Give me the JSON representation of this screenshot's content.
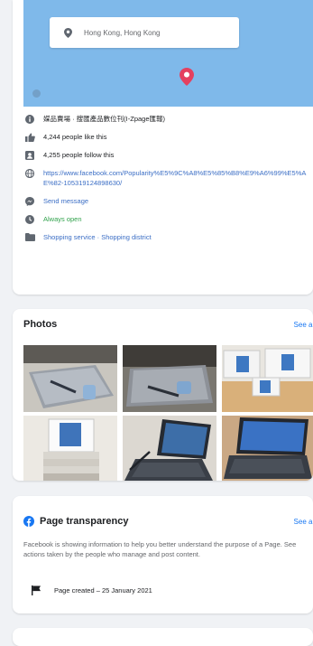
{
  "map": {
    "search_text": "Hong Kong, Hong Kong"
  },
  "info": {
    "category": "媒品賣場 · 搜匯產品數位刊(I-Zpage匯報)",
    "likes": "4,244 people like this",
    "follows": "4,255 people follow this",
    "url": "https://www.facebook.com/Popularity%E5%9C%A8%E5%85%B8%E9%A6%99%E5%AE%82-105319124898630/",
    "send_message": "Send message",
    "hours": "Always open",
    "categories": "Shopping service · Shopping district"
  },
  "photos": {
    "title": "Photos",
    "see_all": "See all"
  },
  "transparency": {
    "title": "Page transparency",
    "see_all": "See all",
    "description": "Facebook is showing information to help you better understand the purpose of a Page. See actions taken by the people who manage and post content.",
    "created": "Page created – 25 January 2021"
  },
  "colors": {
    "map_water": "#7fb9ea",
    "link": "#3b6ec5",
    "green": "#31a24c",
    "accent": "#1877f2",
    "pin": "#e4405f"
  },
  "icons": [
    "location-pin-icon",
    "info-icon",
    "thumbs-up-icon",
    "follow-icon",
    "globe-icon",
    "messenger-icon",
    "clock-icon",
    "folder-icon",
    "facebook-icon",
    "flag-icon"
  ]
}
